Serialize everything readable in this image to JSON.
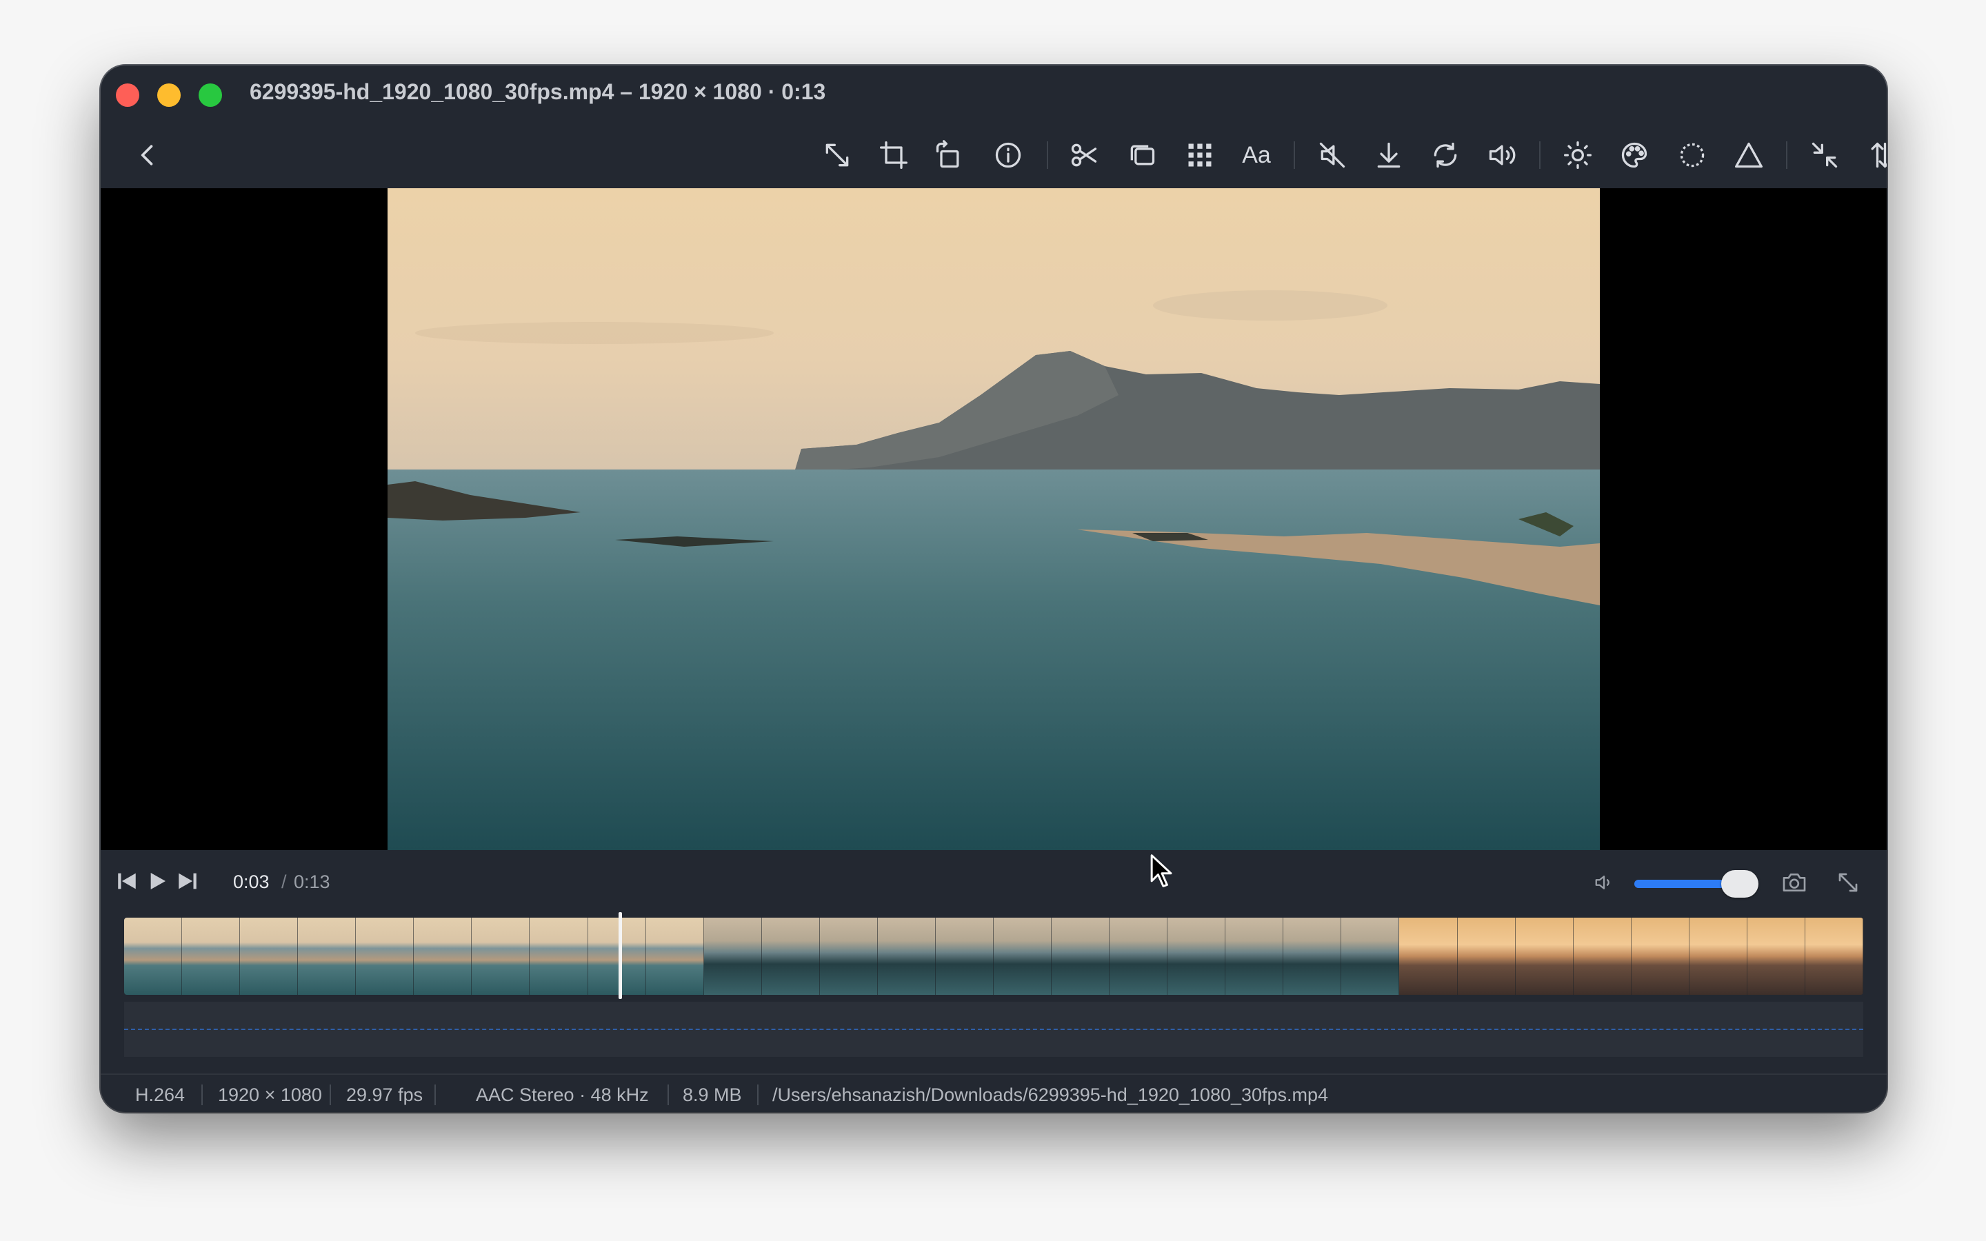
{
  "window": {
    "title": "6299395-hd_1920_1080_30fps.mp4 – 1920 × 1080 · 0:13"
  },
  "toolbar": {
    "icons": [
      "back-icon",
      "resize-icon",
      "crop-icon",
      "rotate-icon",
      "info-icon",
      "scissors-icon",
      "overlay-icon",
      "grid-icon",
      "text-icon",
      "mute-icon",
      "download-icon",
      "loop-icon",
      "volume-icon",
      "brightness-icon",
      "palette-icon",
      "vignette-icon",
      "triangle-icon",
      "compress-icon",
      "sort-icon",
      "share-icon"
    ],
    "text_label": "Aa"
  },
  "playback": {
    "current_time": "0:03",
    "separator": "/",
    "total_time": "0:13",
    "volume_fraction": 0.82,
    "playhead_fraction": 0.284
  },
  "status": {
    "codec": "H.264",
    "resolution": "1920 × 1080",
    "fps": "29.97 fps",
    "audio": "AAC Stereo · 48 kHz",
    "size": "8.9 MB",
    "path": "/Users/ehsanazish/Downloads/6299395-hd_1920_1080_30fps.mp4"
  },
  "colors": {
    "window_bg": "#232831",
    "accent": "#2d7cf6",
    "close": "#fe5f57",
    "minimize": "#febc2e",
    "maximize": "#28c840"
  }
}
